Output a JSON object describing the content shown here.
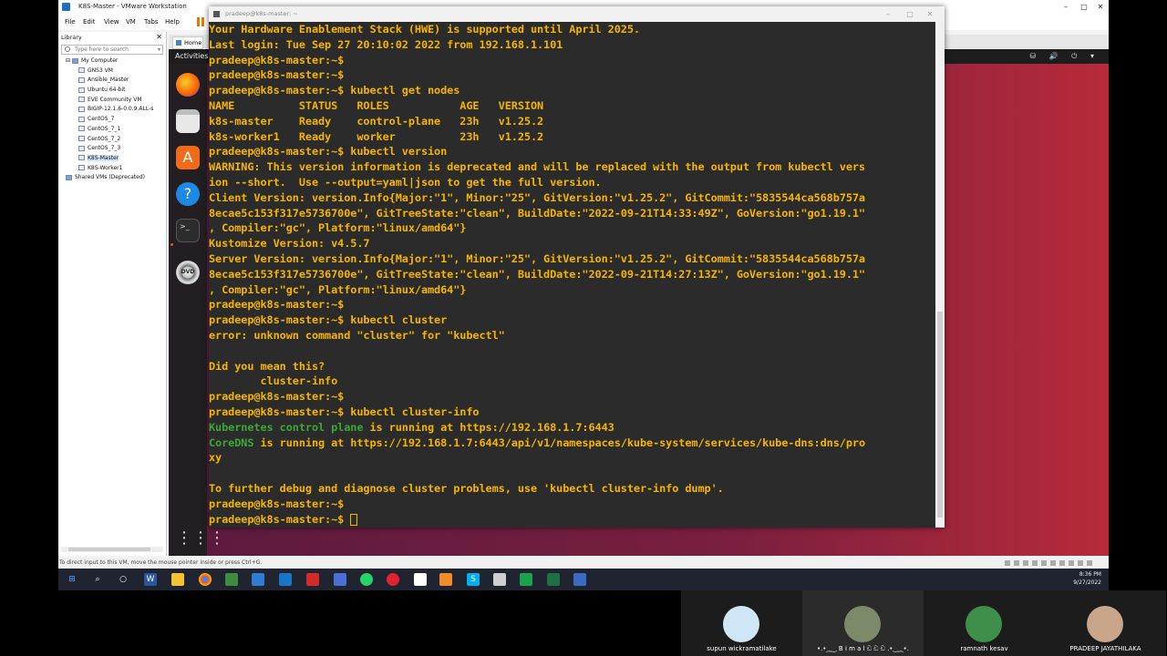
{
  "vmware": {
    "title": "K8S-Master - VMware Workstation",
    "menu": [
      "File",
      "Edit",
      "View",
      "VM",
      "Tabs",
      "Help"
    ],
    "library": {
      "header": "Library",
      "search_placeholder": "Type here to search",
      "items": [
        {
          "label": "My Computer",
          "level": 0
        },
        {
          "label": "GNS3 VM",
          "level": 1
        },
        {
          "label": "Ansible_Master",
          "level": 1
        },
        {
          "label": "Ubuntu 64-bit",
          "level": 1
        },
        {
          "label": "EVE Community VM",
          "level": 1
        },
        {
          "label": "BIGIP-12.1.6-0.0.9.ALL-s",
          "level": 1
        },
        {
          "label": "CentOS_7",
          "level": 1
        },
        {
          "label": "CentOS_7_1",
          "level": 1
        },
        {
          "label": "CentOS_7_2",
          "level": 1
        },
        {
          "label": "CentOS_7_3",
          "level": 1
        },
        {
          "label": "K8S-Master",
          "level": 1
        },
        {
          "label": "K8S-Worker1",
          "level": 1
        },
        {
          "label": "Shared VMs (Deprecated)",
          "level": 0
        }
      ]
    },
    "tab_home": "Home",
    "status_text": "To direct input to this VM, move the mouse pointer inside or press Ctrl+G."
  },
  "ubuntu": {
    "activities": "Activities",
    "tray": "⛁ 🔊 ⏻ ▾"
  },
  "terminal": {
    "title": "pradeep@k8s-master: ~",
    "lines": [
      [
        {
          "t": "Your Hardware Enablement Stack (HWE) is supported until April 2025."
        }
      ],
      [
        {
          "t": "Last login: Tue Sep 27 20:10:02 2022 from 192.168.1.101"
        }
      ],
      [
        {
          "t": "pradeep@k8s-master:~$"
        }
      ],
      [
        {
          "t": "pradeep@k8s-master:~$"
        }
      ],
      [
        {
          "t": "pradeep@k8s-master:~$ kubectl get nodes"
        }
      ],
      [
        {
          "t": "NAME          STATUS   ROLES           AGE   VERSION"
        }
      ],
      [
        {
          "t": "k8s-master    Ready    control-plane   23h   v1.25.2"
        }
      ],
      [
        {
          "t": "k8s-worker1   Ready    worker          23h   v1.25.2"
        }
      ],
      [
        {
          "t": "pradeep@k8s-master:~$ kubectl version"
        }
      ],
      [
        {
          "t": "WARNING: This version information is deprecated and will be replaced with the output from kubectl vers"
        }
      ],
      [
        {
          "t": "ion --short.  Use --output=yaml|json to get the full version."
        }
      ],
      [
        {
          "t": "Client Version: version.Info{Major:\"1\", Minor:\"25\", GitVersion:\"v1.25.2\", GitCommit:\"5835544ca568b757a"
        }
      ],
      [
        {
          "t": "8ecae5c153f317e5736700e\", GitTreeState:\"clean\", BuildDate:\"2022-09-21T14:33:49Z\", GoVersion:\"go1.19.1\""
        }
      ],
      [
        {
          "t": ", Compiler:\"gc\", Platform:\"linux/amd64\"}"
        }
      ],
      [
        {
          "t": "Kustomize Version: v4.5.7"
        }
      ],
      [
        {
          "t": "Server Version: version.Info{Major:\"1\", Minor:\"25\", GitVersion:\"v1.25.2\", GitCommit:\"5835544ca568b757a"
        }
      ],
      [
        {
          "t": "8ecae5c153f317e5736700e\", GitTreeState:\"clean\", BuildDate:\"2022-09-21T14:27:13Z\", GoVersion:\"go1.19.1\""
        }
      ],
      [
        {
          "t": ", Compiler:\"gc\", Platform:\"linux/amd64\"}"
        }
      ],
      [
        {
          "t": "pradeep@k8s-master:~$"
        }
      ],
      [
        {
          "t": "pradeep@k8s-master:~$ kubectl cluster"
        }
      ],
      [
        {
          "t": "error: unknown command \"cluster\" for \"kubectl\""
        }
      ],
      [
        {
          "t": ""
        }
      ],
      [
        {
          "t": "Did you mean this?"
        }
      ],
      [
        {
          "t": "        cluster-info"
        }
      ],
      [
        {
          "t": "pradeep@k8s-master:~$"
        }
      ],
      [
        {
          "t": "pradeep@k8s-master:~$ kubectl cluster-info"
        }
      ],
      [
        {
          "t": "Kubernetes control plane",
          "hl": true
        },
        {
          "t": " is running at https://192.168.1.7:6443"
        }
      ],
      [
        {
          "t": "CoreDNS",
          "hl": true
        },
        {
          "t": " is running at https://192.168.1.7:6443/api/v1/namespaces/kube-system/services/kube-dns:dns/pro"
        }
      ],
      [
        {
          "t": "xy"
        }
      ],
      [
        {
          "t": ""
        }
      ],
      [
        {
          "t": "To further debug and diagnose cluster problems, use 'kubectl cluster-info dump'."
        }
      ],
      [
        {
          "t": "pradeep@k8s-master:~$"
        }
      ],
      [
        {
          "t": "pradeep@k8s-master:~$ ",
          "cursor": true
        }
      ]
    ]
  },
  "taskbar": {
    "time": "8:36 PM",
    "date": "9/27/2022"
  },
  "participants": [
    {
      "name": "supun wickramatilake",
      "avatar_color": "#cfe6f7"
    },
    {
      "name": "•.•⁔‿ B i m a l ඩ ඩ ඩ .•‿⁔•.",
      "avatar_color": "#7d8a6a"
    },
    {
      "name": "ramnath kesav",
      "avatar_color": "#3f8e4a"
    },
    {
      "name": "PRADEEP JAYATHILAKA",
      "avatar_color": "#c9a58a"
    }
  ],
  "colors": {
    "terminal_text": "#f5b400",
    "terminal_highlight": "#3aa834",
    "terminal_bg": "#2b2b2b"
  }
}
